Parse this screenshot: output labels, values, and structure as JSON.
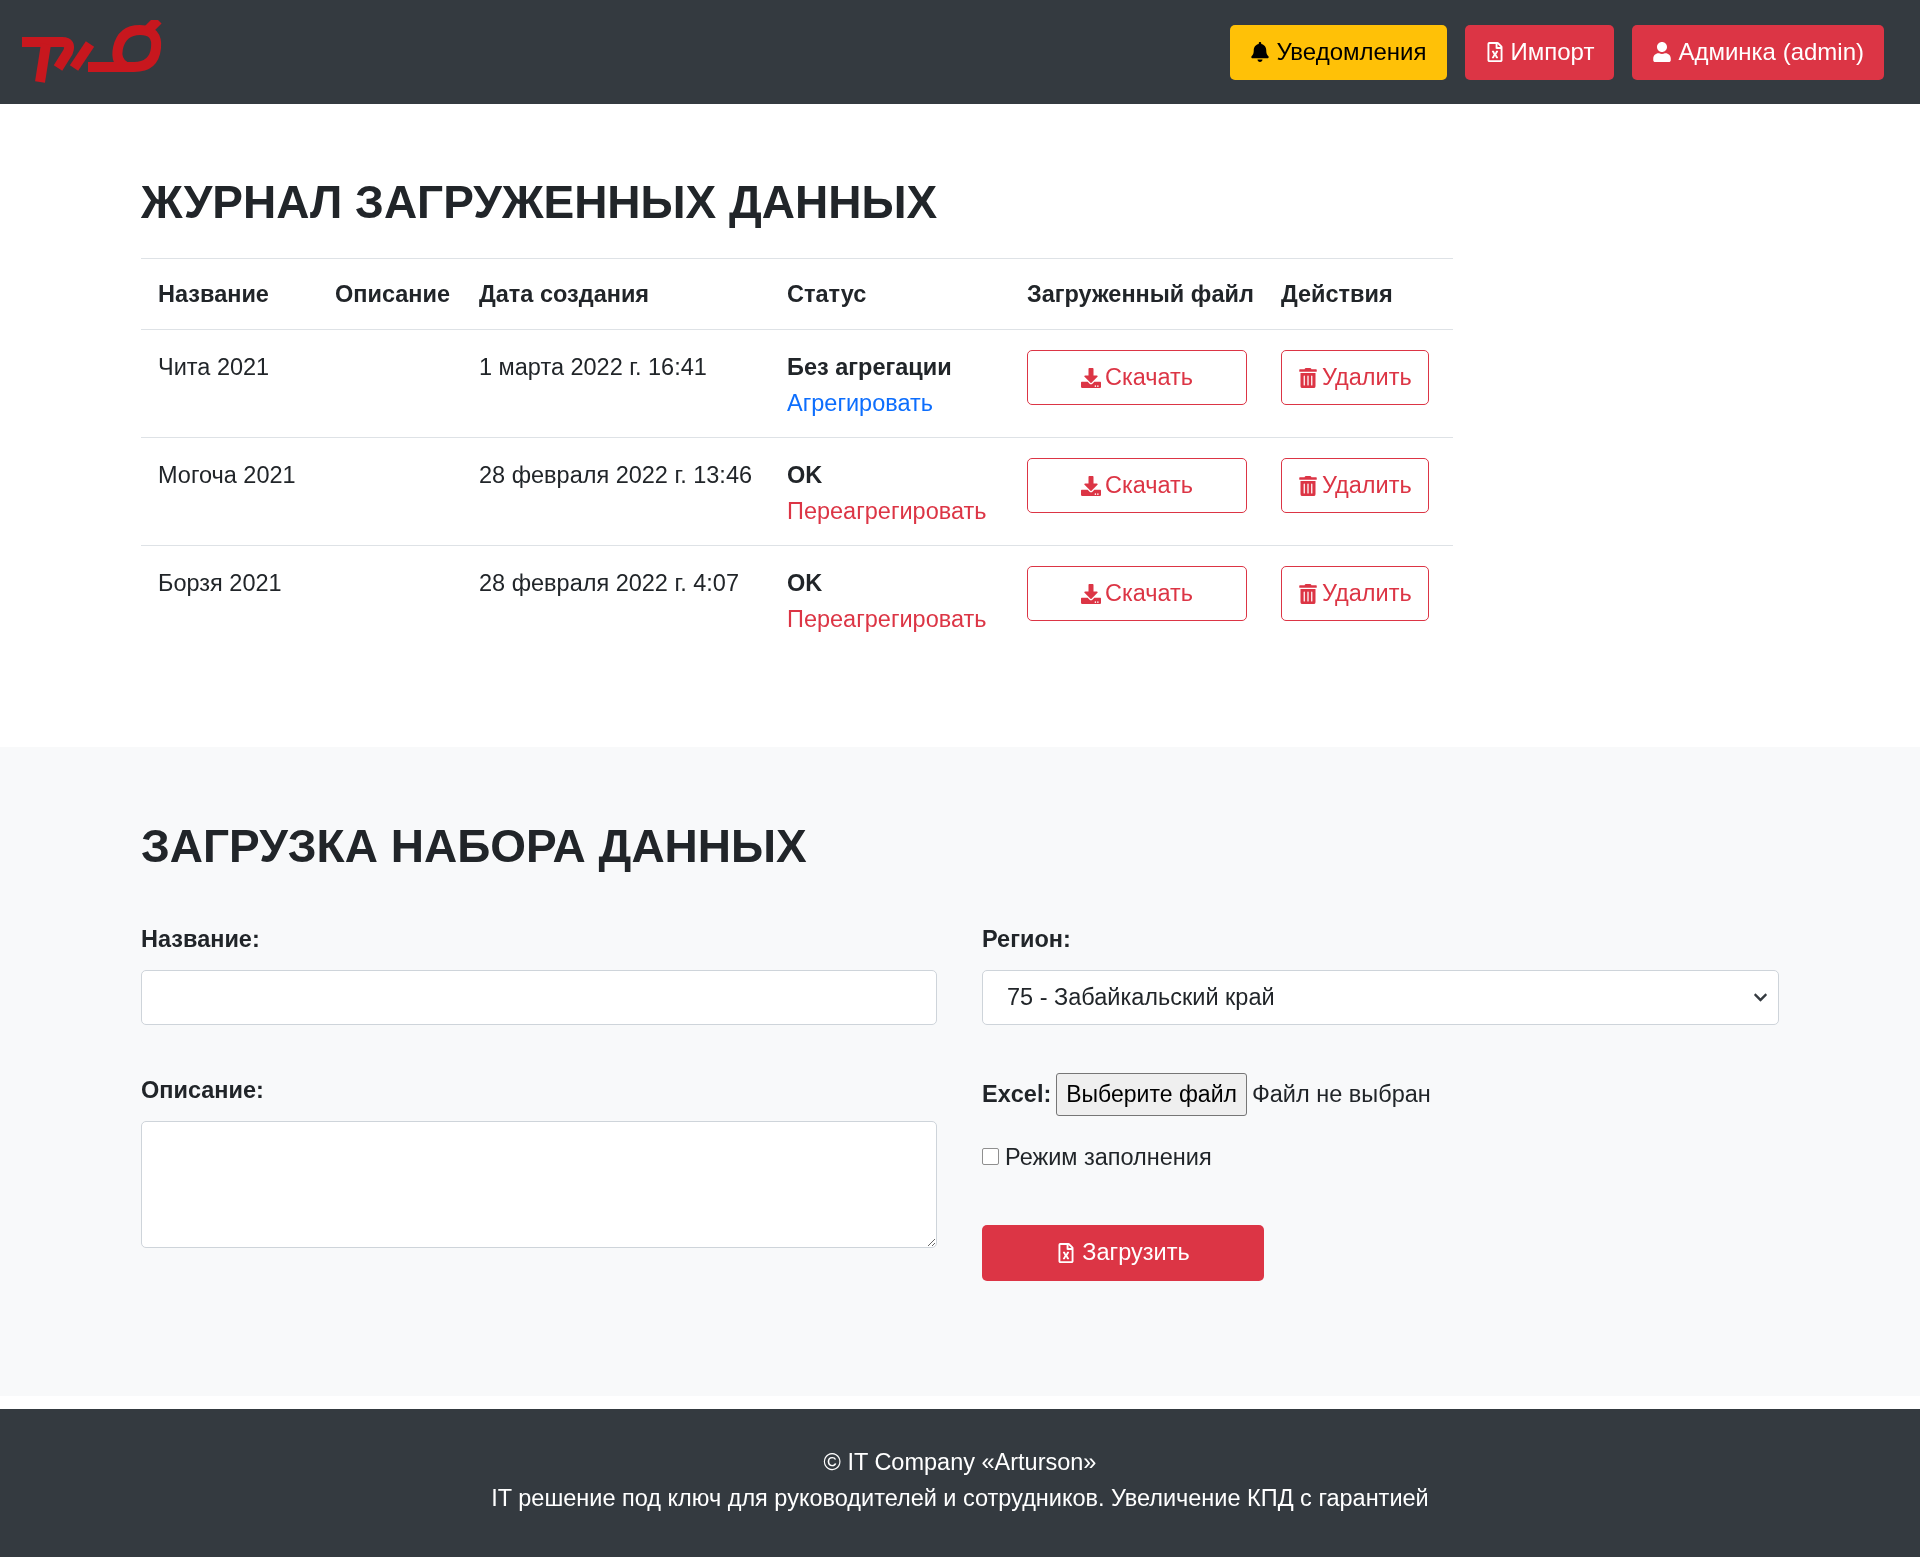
{
  "header": {
    "buttons": [
      {
        "label": "Уведомления",
        "kind": "notifications"
      },
      {
        "label": "Импорт",
        "kind": "import"
      },
      {
        "label": "Админка (admin)",
        "kind": "account"
      }
    ]
  },
  "journal": {
    "title": "ЖУРНАЛ ЗАГРУЖЕННЫХ ДАННЫХ",
    "columns": [
      "Название",
      "Описание",
      "Дата создания",
      "Статус",
      "Загруженный файл",
      "Действия"
    ],
    "rows": [
      {
        "name": "Чита 2021",
        "created": "1 марта 2022 г. 16:41",
        "status": "Без агрегации",
        "status_action": {
          "label": "Агрегировать",
          "kind": "aggregate"
        },
        "file_button": "Скачать",
        "action_button": "Удалить"
      },
      {
        "name": "Могоча 2021",
        "created": "28 февраля 2022 г. 13:46",
        "status": "OK",
        "status_action": {
          "label": "Переагрегировать",
          "kind": "reaggregate"
        },
        "file_button": "Скачать",
        "action_button": "Удалить"
      },
      {
        "name": "Борзя 2021",
        "created": "28 февраля 2022 г. 4:07",
        "status": "OK",
        "status_action": {
          "label": "Переагрегировать",
          "kind": "reaggregate"
        },
        "file_button": "Скачать",
        "action_button": "Удалить"
      }
    ]
  },
  "upload": {
    "title": "ЗАГРУЗКА НАБОРА ДАННЫХ",
    "name_field": {
      "label": "Название:"
    },
    "description_field": {
      "label": "Описание:"
    },
    "region_field": {
      "label": "Регион:",
      "value": "75 - Забайкальский край"
    },
    "excel_field": {
      "label": "Excel:",
      "button": "Выберите файл",
      "file_status": "Файл не выбран"
    },
    "fill_mode": {
      "label": "Режим заполнения",
      "checked": false
    },
    "submit": "Загрузить"
  },
  "footer": {
    "lines": [
      "© IT Company «Arturson»",
      "IT решение под ключ для руководителей и сотрудников. Увеличение КПД с гарантией"
    ]
  }
}
